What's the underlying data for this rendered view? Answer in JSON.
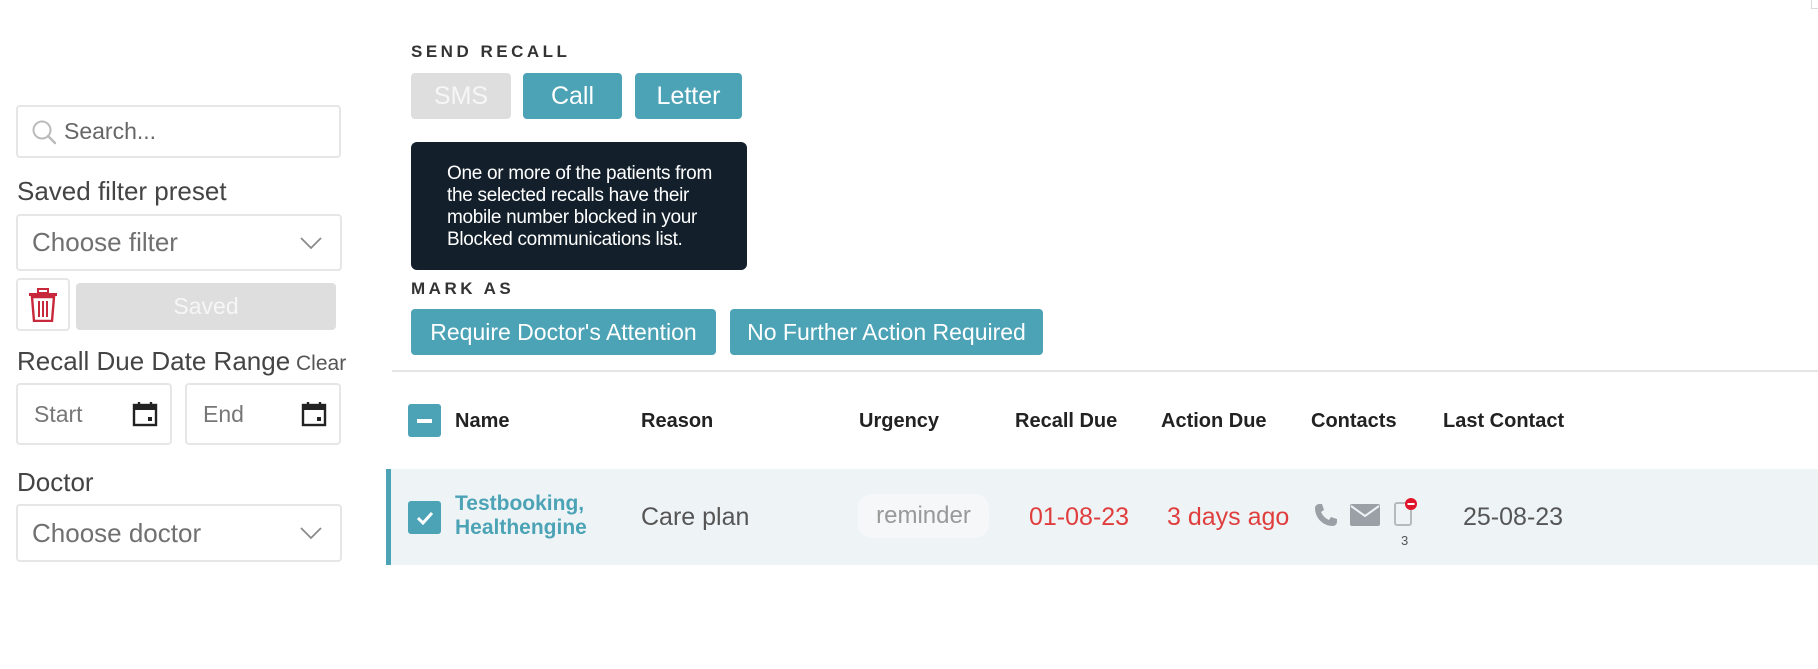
{
  "sidebar": {
    "search": {
      "placeholder": "Search..."
    },
    "preset": {
      "label": "Saved filter preset",
      "placeholder": "Choose filter",
      "saved_button": "Saved"
    },
    "date_range": {
      "label": "Recall Due Date Range",
      "clear": "Clear",
      "start_placeholder": "Start",
      "end_placeholder": "End"
    },
    "doctor": {
      "label": "Doctor",
      "placeholder": "Choose doctor"
    }
  },
  "send_recall": {
    "title": "SEND RECALL",
    "buttons": {
      "sms": "SMS",
      "call": "Call",
      "letter": "Letter"
    },
    "tooltip": [
      "One or more of the patients from",
      "the selected recalls have their",
      "mobile number blocked in your",
      "Blocked communications list."
    ]
  },
  "mark_as": {
    "title": "MARK AS",
    "buttons": {
      "doctor_attention": "Require Doctor's Attention",
      "no_action": "No Further Action Required"
    }
  },
  "table": {
    "headers": {
      "name": "Name",
      "reason": "Reason",
      "urgency": "Urgency",
      "recall_due": "Recall Due",
      "action_due": "Action Due",
      "contacts": "Contacts",
      "last_contact": "Last Contact"
    },
    "rows": [
      {
        "name_line1": "Testbooking,",
        "name_line2": "Healthengine",
        "reason": "Care plan",
        "urgency": "reminder",
        "recall_due": "01-08-23",
        "action_due": "3 days ago",
        "contacts_count": "3",
        "last_contact": "25-08-23"
      }
    ]
  },
  "colors": {
    "accent": "#4ca3b6",
    "danger": "#e03e3e",
    "tooltip_bg": "#13202b",
    "row_bg": "#eef4f6"
  }
}
